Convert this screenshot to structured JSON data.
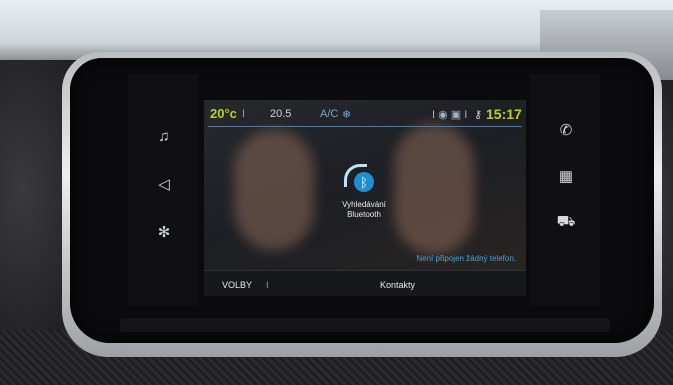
{
  "status_bar": {
    "outside_temp": "20°c",
    "separator": "I",
    "cabin_temp": "20.5",
    "ac_label": "A/C",
    "fan_glyph": "❄",
    "tray_icons": "I ◉ ▣ I",
    "time": "15:17"
  },
  "bluetooth": {
    "label_line1": "Vyhledávání",
    "label_line2": "Bluetooth"
  },
  "message": "Není připojen žádný telefon.",
  "bottom_bar": {
    "options_label": "VOLBY",
    "separator": "I",
    "contacts_label": "Kontakty"
  },
  "left_icons": [
    "music-icon",
    "navigation-icon",
    "climate-fan-icon"
  ],
  "right_icons": [
    "phone-icon",
    "apps-grid-icon",
    "car-icon"
  ],
  "colors": {
    "accent_green": "#b8d21e",
    "accent_blue": "#3aa5e0",
    "bluetooth_blue": "#1f8ecf"
  }
}
